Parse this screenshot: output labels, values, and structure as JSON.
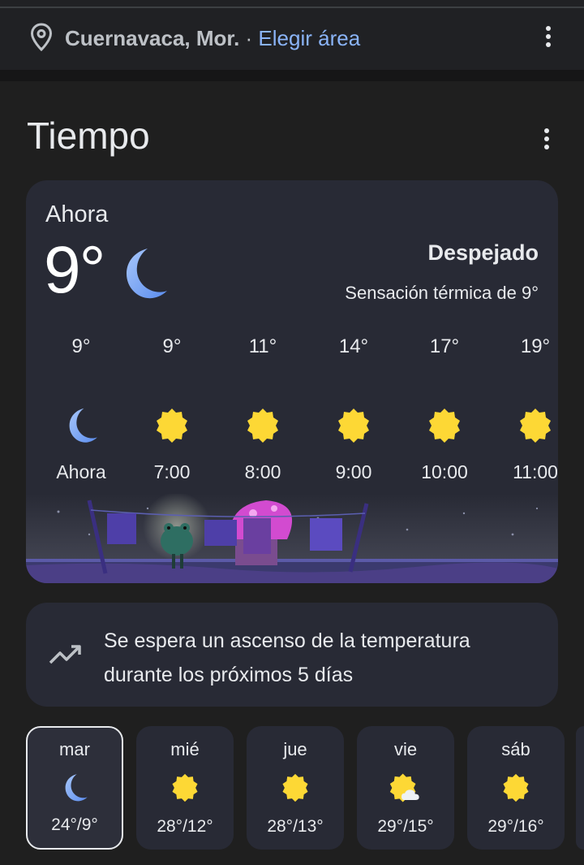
{
  "location": {
    "city": "Cuernavaca, Mor.",
    "separator": " · ",
    "change_link": "Elegir área"
  },
  "section_title": "Tiempo",
  "current": {
    "label": "Ahora",
    "temperature": "9°",
    "icon": "moon-icon",
    "condition": "Despejado",
    "feels_like": "Sensación térmica de 9°"
  },
  "hourly": [
    {
      "temp": "9°",
      "time": "Ahora",
      "icon": "moon-icon"
    },
    {
      "temp": "9°",
      "time": "7:00",
      "icon": "sun-icon"
    },
    {
      "temp": "11°",
      "time": "8:00",
      "icon": "sun-icon"
    },
    {
      "temp": "14°",
      "time": "9:00",
      "icon": "sun-icon"
    },
    {
      "temp": "17°",
      "time": "10:00",
      "icon": "sun-icon"
    },
    {
      "temp": "19°",
      "time": "11:00",
      "icon": "sun-icon"
    }
  ],
  "trend": {
    "icon": "trending-up-icon",
    "text": "Se espera un ascenso de la temperatura durante los próximos 5 días"
  },
  "daily": [
    {
      "day": "mar",
      "range": "24°/9°",
      "icon": "moon-icon",
      "selected": true
    },
    {
      "day": "mié",
      "range": "28°/12°",
      "icon": "sun-icon"
    },
    {
      "day": "jue",
      "range": "28°/13°",
      "icon": "sun-icon"
    },
    {
      "day": "vie",
      "range": "29°/15°",
      "icon": "sun-cloud-icon"
    },
    {
      "day": "sáb",
      "range": "29°/16°",
      "icon": "sun-icon"
    }
  ],
  "colors": {
    "background": "#202124",
    "card": "#282a35",
    "link": "#8ab4f8",
    "sun": "#fdd835",
    "moon": "#8ab4f8"
  }
}
